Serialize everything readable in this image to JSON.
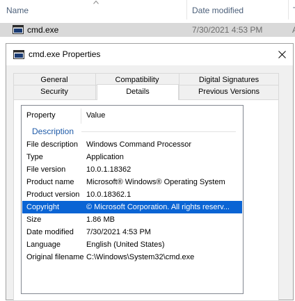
{
  "explorer": {
    "columns": {
      "name": "Name",
      "date_modified": "Date modified",
      "type_partial": "T"
    },
    "file": {
      "name": "cmd.exe",
      "date": "7/30/2021 4:53 PM",
      "extra": "A"
    }
  },
  "dialog": {
    "title": "cmd.exe Properties",
    "tabs_row1": [
      "General",
      "Compatibility",
      "Digital Signatures"
    ],
    "tabs_row2": [
      "Security",
      "Details",
      "Previous Versions"
    ],
    "active_tab": "Details",
    "list": {
      "header_property": "Property",
      "header_value": "Value",
      "group": "Description",
      "rows": [
        {
          "k": "File description",
          "v": "Windows Command Processor"
        },
        {
          "k": "Type",
          "v": "Application"
        },
        {
          "k": "File version",
          "v": "10.0.1.18362"
        },
        {
          "k": "Product name",
          "v": "Microsoft® Windows® Operating System"
        },
        {
          "k": "Product version",
          "v": "10.0.18362.1"
        },
        {
          "k": "Copyright",
          "v": "© Microsoft Corporation. All rights reserv..."
        },
        {
          "k": "Size",
          "v": "1.86 MB"
        },
        {
          "k": "Date modified",
          "v": "7/30/2021 4:53 PM"
        },
        {
          "k": "Language",
          "v": "English (United States)"
        },
        {
          "k": "Original filename",
          "v": "C:\\Windows\\System32\\cmd.exe"
        }
      ],
      "selected_row": "Copyright"
    }
  },
  "colors": {
    "selection": "#0a64d4",
    "group_text": "#1e5aa8",
    "file_row_bg": "#d9d9d9"
  }
}
